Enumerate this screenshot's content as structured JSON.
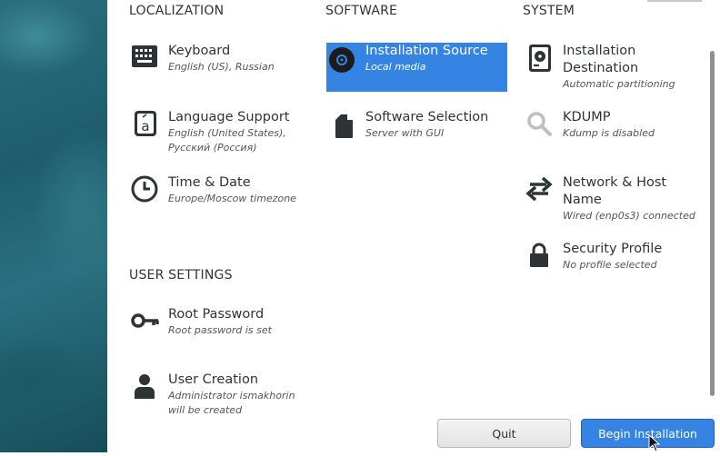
{
  "sections": {
    "localization": "LOCALIZATION",
    "software": "SOFTWARE",
    "system": "SYSTEM",
    "user_settings": "USER SETTINGS"
  },
  "spokes": {
    "keyboard": {
      "title": "Keyboard",
      "status": "English (US), Russian",
      "icon": "keyboard-icon"
    },
    "language": {
      "title": "Language Support",
      "status1": "English (United States),",
      "status2": "Русский (Россия)",
      "icon": "language-icon"
    },
    "time": {
      "title": "Time & Date",
      "status": "Europe/Moscow timezone",
      "icon": "clock-icon"
    },
    "source": {
      "title": "Installation Source",
      "status": "Local media",
      "icon": "disc-icon"
    },
    "software": {
      "title": "Software Selection",
      "status": "Server with GUI",
      "icon": "package-icon"
    },
    "destination": {
      "title1": "Installation",
      "title2": "Destination",
      "status": "Automatic partitioning",
      "icon": "drive-icon"
    },
    "kdump": {
      "title": "KDUMP",
      "status": "Kdump is disabled",
      "icon": "magnifier-icon"
    },
    "network": {
      "title1": "Network & Host",
      "title2": "Name",
      "status": "Wired (enp0s3) connected",
      "icon": "network-arrows-icon"
    },
    "security": {
      "title": "Security Profile",
      "status": "No profile selected",
      "icon": "lock-icon"
    },
    "root": {
      "title": "Root Password",
      "status": "Root password is set",
      "icon": "key-icon"
    },
    "user": {
      "title": "User Creation",
      "status1": "Administrator ismakhorin",
      "status2": "will be created",
      "icon": "user-icon"
    }
  },
  "buttons": {
    "quit": "Quit",
    "begin": "Begin Installation"
  },
  "colors": {
    "accent": "#3584e4",
    "sidebar": "#1f5d6c"
  }
}
